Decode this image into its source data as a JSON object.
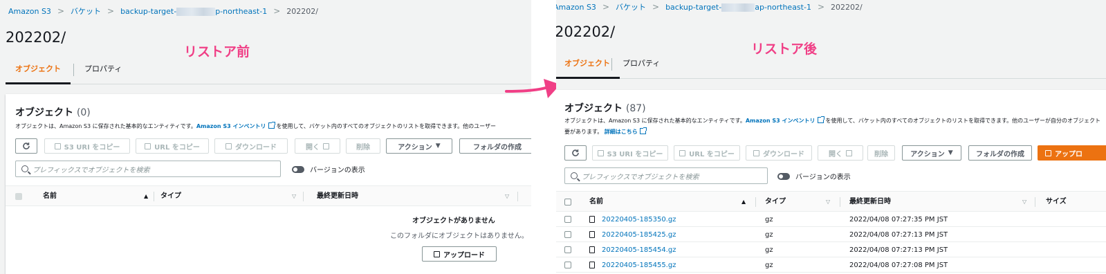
{
  "colors": {
    "link": "#0073bb",
    "accent_orange": "#ec7211",
    "annotation_pink": "#f03f86",
    "background": "#f2f3f3"
  },
  "breadcrumb": {
    "root": "Amazon S3",
    "buckets": "バケット",
    "bucket_prefix": "backup-target-",
    "bucket_suffix": "p-northeast-1",
    "bucket_suffix_right": "ap-northeast-1",
    "current": "202202/"
  },
  "page": {
    "title": "202202/"
  },
  "annotations": {
    "before": "リストア前",
    "after": "リストア後"
  },
  "tabs": {
    "objects": "オブジェクト",
    "properties": "プロパティ"
  },
  "card": {
    "title": "オブジェクト",
    "count_before": "(0)",
    "count_after": "(87)",
    "desc_prefix": "オブジェクトは、Amazon S3 に保存された基本的なエンティティです。",
    "desc_link": "Amazon S3 インベントリ",
    "desc_suffix_left": "を使用して、バケット内のすべてのオブジェクトのリストを取得できます。他のユーザー",
    "desc_suffix_right": "を使用して、バケット内のすべてのオブジェクトのリストを取得できます。他のユーザーが自分のオブジェクト",
    "desc_line2": "要があります。",
    "details_link": "詳細はこちら"
  },
  "toolbar": {
    "refresh": "refresh-icon",
    "copy_s3_uri": "S3 URI をコピー",
    "copy_url": "URL をコピー",
    "download": "ダウンロード",
    "open": "開く",
    "delete": "削除",
    "actions": "アクション",
    "create_folder": "フォルダの作成",
    "upload": "アップロ"
  },
  "search": {
    "placeholder": "プレフィックスでオブジェクトを検索"
  },
  "versions_toggle": "バージョンの表示",
  "table": {
    "columns": [
      "名前",
      "タイプ",
      "最終更新日時",
      "サイズ"
    ],
    "rows": [
      {
        "name": "20220405-185350.gz",
        "type": "gz",
        "modified": "2022/04/08 07:27:35 PM JST"
      },
      {
        "name": "20220405-185425.gz",
        "type": "gz",
        "modified": "2022/04/08 07:27:13 PM JST"
      },
      {
        "name": "20220405-185454.gz",
        "type": "gz",
        "modified": "2022/04/08 07:27:13 PM JST"
      },
      {
        "name": "20220405-185455.gz",
        "type": "gz",
        "modified": "2022/04/08 07:27:08 PM JST"
      }
    ]
  },
  "empty_state": {
    "title": "オブジェクトがありません",
    "subtitle": "このフォルダにオブジェクトはありません。",
    "upload_button": "アップロード"
  }
}
